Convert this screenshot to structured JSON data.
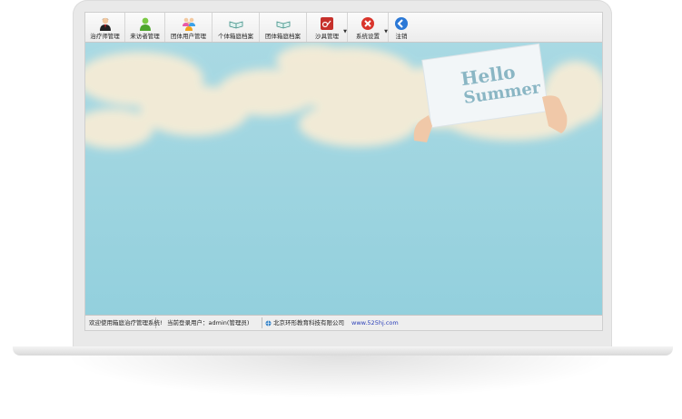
{
  "toolbar": {
    "buttons": [
      {
        "label": "治疗师管理",
        "icon": "therapist-icon"
      },
      {
        "label": "来访者管理",
        "icon": "visitor-icon"
      },
      {
        "label": "团体用户管理",
        "icon": "group-users-icon"
      },
      {
        "label": "个体箱庭档案",
        "icon": "book-icon"
      },
      {
        "label": "团体箱庭档案",
        "icon": "book-icon"
      },
      {
        "label": "沙具管理",
        "icon": "sand-tool-icon"
      },
      {
        "label": "系统设置",
        "icon": "settings-icon"
      },
      {
        "label": "注销",
        "icon": "logout-icon"
      }
    ]
  },
  "banner": {
    "sign_line1": "Hello",
    "sign_line2": "Summer"
  },
  "statusbar": {
    "welcome": "欢迎使用箱庭治疗管理系统!",
    "current_user": "当前登录用户：admin(管理员)",
    "company": "北京环形教育科技有限公司",
    "website": "www.525hj.com"
  }
}
